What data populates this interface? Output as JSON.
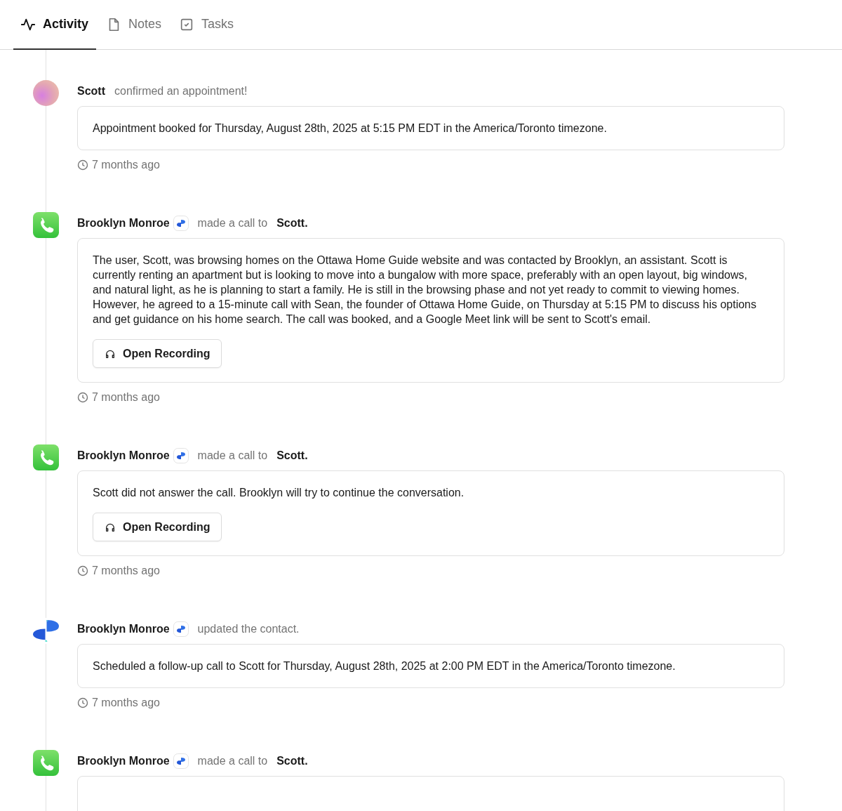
{
  "tabs": [
    {
      "label": "Activity",
      "kind": "activity",
      "selected": true
    },
    {
      "label": "Notes",
      "kind": "note",
      "selected": false
    },
    {
      "label": "Tasks",
      "kind": "task",
      "selected": false
    }
  ],
  "activities": [
    {
      "avatar": {
        "kind": "gradient"
      },
      "actor": "Scott",
      "actor_badge": false,
      "action": "confirmed an appointment!",
      "body": "Appointment booked for Thursday, August 28th, 2025 at 5:15 PM EDT in the America/Toronto timezone.",
      "time": "7 months ago"
    },
    {
      "avatar": {
        "kind": "phone"
      },
      "actor": "Brooklyn Monroe",
      "actor_badge": true,
      "action": "made a call to",
      "target": "Scott.",
      "body": "The user, Scott, was browsing homes on the Ottawa Home Guide website and was contacted by Brooklyn, an assistant. Scott is currently renting an apartment but is looking to move into a bungalow with more space, preferably with an open layout, big windows, and natural light, as he is planning to start a family. He is still in the browsing phase and not yet ready to commit to viewing homes. However, he agreed to a 15-minute call with Sean, the founder of Ottawa Home Guide, on Thursday at 5:15 PM to discuss his options and get guidance on his home search. The call was booked, and a Google Meet link will be sent to Scott's email.",
      "button": "Open Recording",
      "time": "7 months ago"
    },
    {
      "avatar": {
        "kind": "phone"
      },
      "actor": "Brooklyn Monroe",
      "actor_badge": true,
      "action": "made a call to",
      "target": "Scott.",
      "body": "Scott did not answer the call. Brooklyn will try to continue the conversation.",
      "button": "Open Recording",
      "time": "7 months ago"
    },
    {
      "avatar": {
        "kind": "logo"
      },
      "actor": "Brooklyn Monroe",
      "actor_badge": true,
      "action": "updated the contact.",
      "body": "Scheduled a follow-up call to Scott for Thursday, August 28th, 2025 at 2:00 PM EDT in the America/Toronto timezone.",
      "time": "7 months ago"
    },
    {
      "avatar": {
        "kind": "phone"
      },
      "actor": "Brooklyn Monroe",
      "actor_badge": true,
      "action": "made a call to",
      "target": "Scott."
    }
  ]
}
